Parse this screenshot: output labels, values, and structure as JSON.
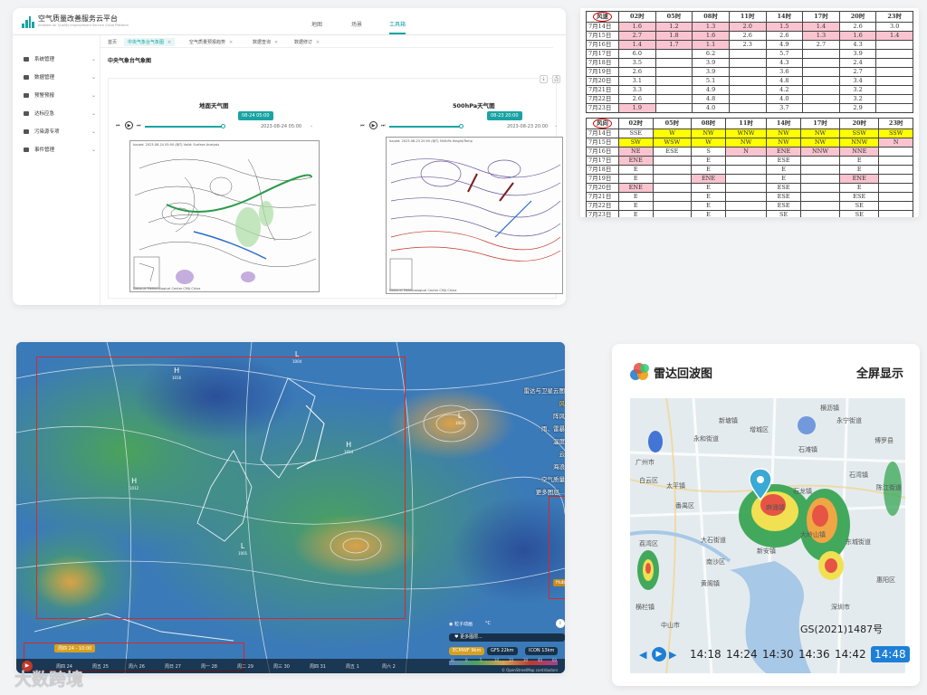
{
  "platform": {
    "title": "空气质量改善服务云平台",
    "subtitle": "Ambient Air Quality Improvement Service Cloud Platform",
    "nav": [
      "地图",
      "场景",
      "工具箱"
    ],
    "active_nav": "工具箱",
    "sidebar": [
      "系统管理",
      "数据管理",
      "预警预报",
      "达标应急",
      "污染源专项",
      "事件管理"
    ],
    "tabs": [
      {
        "label": "首页",
        "active": false
      },
      {
        "label": "中央气象台气象图",
        "active": true
      },
      {
        "label": "空气质量预报趋势",
        "active": false
      },
      {
        "label": "数据查询",
        "active": false
      },
      {
        "label": "数据修订",
        "active": false
      }
    ],
    "page_title": "中央气象台气象图",
    "charts": [
      {
        "title": "地面天气图",
        "badge": "08-24 05:00",
        "timestamp": "2023-08-24 05:00",
        "progress": 0.72,
        "caption": "Issued: 2023-08-24 05:00 (BJT) Valid: Surface Analysis",
        "footer": "National Meteorological Center CMA China"
      },
      {
        "title": "500hPa天气图",
        "badge": "08-23 20:00",
        "timestamp": "2023-08-23 20:00",
        "progress": 0.66,
        "caption": "Issued: 2023-08-23 20:00 (BJT) 500hPa Height/Temp",
        "footer": "National Meteorological Center CMA China"
      }
    ]
  },
  "wind_table": {
    "header_label": "风速",
    "hours": [
      "02时",
      "05时",
      "08时",
      "11时",
      "14时",
      "17时",
      "20时",
      "23时"
    ],
    "rows": [
      {
        "date": "7月14日",
        "v": [
          "1.6",
          "1.2",
          "1.3",
          "2.0",
          "1.5",
          "1.4",
          "2.6",
          "3.0"
        ],
        "hl": [
          1,
          1,
          1,
          1,
          1,
          1,
          0,
          0
        ]
      },
      {
        "date": "7月15日",
        "v": [
          "2.7",
          "1.8",
          "1.6",
          "2.6",
          "2.6",
          "1.3",
          "1.6",
          "1.4"
        ],
        "hl": [
          1,
          1,
          1,
          0,
          0,
          1,
          1,
          1
        ]
      },
      {
        "date": "7月16日",
        "v": [
          "1.4",
          "1.7",
          "1.1",
          "2.3",
          "4.9",
          "2.7",
          "4.3",
          ""
        ],
        "hl": [
          1,
          1,
          1,
          0,
          0,
          0,
          0,
          0
        ]
      },
      {
        "date": "7月17日",
        "v": [
          "6.0",
          "",
          "6.2",
          "",
          "5.7",
          "",
          "3.9",
          ""
        ],
        "hl": [
          0,
          0,
          0,
          0,
          0,
          0,
          0,
          0
        ]
      },
      {
        "date": "7月18日",
        "v": [
          "3.5",
          "",
          "3.9",
          "",
          "4.3",
          "",
          "2.4",
          ""
        ],
        "hl": [
          0,
          0,
          0,
          0,
          0,
          0,
          0,
          0
        ]
      },
      {
        "date": "7月19日",
        "v": [
          "2.6",
          "",
          "3.9",
          "",
          "3.6",
          "",
          "2.7",
          ""
        ],
        "hl": [
          0,
          0,
          0,
          0,
          0,
          0,
          0,
          0
        ]
      },
      {
        "date": "7月20日",
        "v": [
          "3.1",
          "",
          "5.1",
          "",
          "4.8",
          "",
          "3.4",
          ""
        ],
        "hl": [
          0,
          0,
          0,
          0,
          0,
          0,
          0,
          0
        ]
      },
      {
        "date": "7月21日",
        "v": [
          "3.3",
          "",
          "4.9",
          "",
          "4.2",
          "",
          "3.2",
          ""
        ],
        "hl": [
          0,
          0,
          0,
          0,
          0,
          0,
          0,
          0
        ]
      },
      {
        "date": "7月22日",
        "v": [
          "2.6",
          "",
          "4.8",
          "",
          "4.0",
          "",
          "3.2",
          ""
        ],
        "hl": [
          0,
          0,
          0,
          0,
          0,
          0,
          0,
          0
        ]
      },
      {
        "date": "7月23日",
        "v": [
          "1.9",
          "",
          "4.0",
          "",
          "3.7",
          "",
          "2.9",
          ""
        ],
        "hl": [
          1,
          0,
          0,
          0,
          0,
          0,
          0,
          0
        ]
      }
    ]
  },
  "dir_table": {
    "header_label": "风向",
    "hours": [
      "02时",
      "05时",
      "08时",
      "11时",
      "14时",
      "17时",
      "20时",
      "23时"
    ],
    "rows": [
      {
        "date": "7月14日",
        "v": [
          "SSE",
          "W",
          "NW",
          "WNW",
          "NW",
          "NW",
          "SSW",
          "SSW"
        ],
        "hl": [
          "",
          "y",
          "y",
          "y",
          "y",
          "y",
          "y",
          "y"
        ]
      },
      {
        "date": "7月15日",
        "v": [
          "SW",
          "WSW",
          "W",
          "NW",
          "NW",
          "NW",
          "NNW",
          "N"
        ],
        "hl": [
          "y",
          "y",
          "y",
          "y",
          "y",
          "y",
          "y",
          "p"
        ]
      },
      {
        "date": "7月16日",
        "v": [
          "NE",
          "ESE",
          "S",
          "N",
          "ENE",
          "NNW",
          "NNE",
          ""
        ],
        "hl": [
          "p",
          "",
          "",
          "p",
          "p",
          "p",
          "p",
          ""
        ]
      },
      {
        "date": "7月17日",
        "v": [
          "ENE",
          "",
          "E",
          "",
          "ESE",
          "",
          "E",
          ""
        ],
        "hl": [
          "p",
          "",
          "",
          "",
          "",
          "",
          "",
          ""
        ]
      },
      {
        "date": "7月18日",
        "v": [
          "E",
          "",
          "E",
          "",
          "E",
          "",
          "E",
          ""
        ],
        "hl": [
          "",
          "",
          "",
          "",
          "",
          "",
          "",
          ""
        ]
      },
      {
        "date": "7月19日",
        "v": [
          "E",
          "",
          "ENE",
          "",
          "E",
          "",
          "ENE",
          ""
        ],
        "hl": [
          "",
          "",
          "p",
          "",
          "",
          "",
          "p",
          ""
        ]
      },
      {
        "date": "7月20日",
        "v": [
          "ENE",
          "",
          "E",
          "",
          "ESE",
          "",
          "E",
          ""
        ],
        "hl": [
          "p",
          "",
          "",
          "",
          "",
          "",
          "",
          ""
        ]
      },
      {
        "date": "7月21日",
        "v": [
          "E",
          "",
          "E",
          "",
          "ESE",
          "",
          "ESE",
          ""
        ],
        "hl": [
          "",
          "",
          "",
          "",
          "",
          "",
          "",
          ""
        ]
      },
      {
        "date": "7月22日",
        "v": [
          "E",
          "",
          "E",
          "",
          "ESE",
          "",
          "SE",
          ""
        ],
        "hl": [
          "",
          "",
          "",
          "",
          "",
          "",
          "",
          ""
        ]
      },
      {
        "date": "7月23日",
        "v": [
          "E",
          "",
          "E",
          "",
          "SE",
          "",
          "SE",
          ""
        ],
        "hl": [
          "",
          "",
          "",
          "",
          "",
          "",
          "",
          ""
        ]
      }
    ]
  },
  "windy": {
    "layers": [
      "雷达与卫星云图",
      "风",
      "阵风",
      "雨、雷暴",
      "温度",
      "云",
      "海浪",
      "空气质量",
      "更多图层..."
    ],
    "active_layer": "风",
    "date_label": "周四 24 - 10:00",
    "days": [
      "周四 24",
      "周五 25",
      "周六 26",
      "周日 27",
      "周一 28",
      "周二 29",
      "周三 30",
      "周四 31",
      "周五 1",
      "周六 2"
    ],
    "models": [
      "ECMWF 9km",
      "GFS 22km",
      "ICON 13km"
    ],
    "active_model": "ECMWF 9km",
    "particles": "粒子动画",
    "unit": "°C",
    "more": "更多图层...",
    "speed_scale": [
      "kt",
      "0",
      "5",
      "10",
      "20",
      "30",
      "40",
      "60"
    ],
    "copyright": "© OpenStreetMap contributors",
    "legend_badge": "Hub",
    "pressure_centers": [
      {
        "label": "H",
        "value": "1016"
      },
      {
        "label": "L",
        "value": "1004"
      },
      {
        "label": "H",
        "value": "1012"
      },
      {
        "label": "L",
        "value": "1003"
      },
      {
        "label": "L",
        "value": "1001"
      },
      {
        "label": "H",
        "value": "1014"
      }
    ]
  },
  "radar": {
    "title": "雷达回波图",
    "fullscreen": "全屏显示",
    "copyright": "GS(2021)1487号",
    "times": [
      "14:18",
      "14:24",
      "14:30",
      "14:36",
      "14:42",
      "14:48"
    ],
    "active_time": "14:48",
    "places": [
      "横沥镇",
      "新塘镇",
      "增城区",
      "石滩镇",
      "麻涌镇",
      "永和街道",
      "广州市",
      "太平镇",
      "白云区",
      "荔湾区",
      "番禺区",
      "南沙区",
      "东城街道",
      "博罗县",
      "石湾镇",
      "陈江街道",
      "中山市",
      "大岭山镇",
      "深圳市",
      "惠阳区",
      "新安镇",
      "石龙镇",
      "永宁街道",
      "大石街道",
      "黄阁镇",
      "横栏镇"
    ]
  },
  "watermark": "大数跨境",
  "colors": {
    "accent": "#1aa3a3",
    "pink": "#f9c4cf",
    "yellow": "#ffff00",
    "radar_active": "#1e7fd6",
    "red_box": "#d42a2a"
  }
}
